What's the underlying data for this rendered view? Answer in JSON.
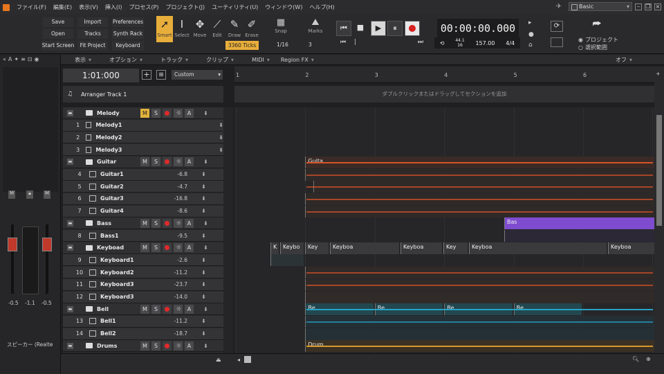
{
  "menu": [
    "ファイル(F)",
    "編集(E)",
    "表示(V)",
    "挿入(I)",
    "プロセス(P)",
    "プロジェクト(J)",
    "ユーティリティ(U)",
    "ウィンドウ(W)",
    "ヘルプ(H)"
  ],
  "workspace": "Basic",
  "toolbar": {
    "buttons": [
      "Save",
      "Import",
      "Preferences",
      "Open",
      "Tracks",
      "Synth Rack",
      "Start Screen",
      "Fit Project",
      "Keyboard"
    ],
    "tools": [
      "Smart",
      "Select",
      "Move",
      "Edit",
      "Draw",
      "Erase"
    ],
    "ticks": "3360 Ticks",
    "snap_label": "Snap",
    "snap_value": "1/16",
    "snap_num": "3",
    "marks_label": "Marks"
  },
  "transport": {
    "time": "00:00:00.000",
    "sample_rate": "44.1",
    "bit_depth": "16",
    "tempo": "157.00",
    "meter": "4/4",
    "project_label": "プロジェクト",
    "selection_label": "選択範囲"
  },
  "track_header": {
    "view_menus": [
      "表示",
      "オプション",
      "トラック",
      "クリップ",
      "MIDI",
      "Region FX"
    ],
    "now_time": "1:01:000",
    "preset": "Custom",
    "off_label": "オフ"
  },
  "arranger": {
    "name": "Arranger Track 1",
    "hint": "ダブルクリックまたはドラッグしてセクションを追加"
  },
  "ruler": [
    "1",
    "2",
    "3",
    "4",
    "5",
    "6"
  ],
  "mixer": {
    "vol_left": "-0.5",
    "vol_mid": "-1.1",
    "vol_right": "-0.5",
    "output": "スピーカー (Realte"
  },
  "tracks": [
    {
      "type": "folder",
      "name": "Melody",
      "mute": true
    },
    {
      "type": "track",
      "num": "1",
      "name": "Melody1",
      "vol": ""
    },
    {
      "type": "track",
      "num": "2",
      "name": "Melody2",
      "vol": ""
    },
    {
      "type": "track",
      "num": "3",
      "name": "Melody3",
      "vol": ""
    },
    {
      "type": "folder",
      "name": "Guitar"
    },
    {
      "type": "track",
      "num": "4",
      "name": "Guitar1",
      "vol": "-6.8"
    },
    {
      "type": "track",
      "num": "5",
      "name": "Guitar2",
      "vol": "-4.7"
    },
    {
      "type": "track",
      "num": "6",
      "name": "Guitar3",
      "vol": "-16.8"
    },
    {
      "type": "track",
      "num": "7",
      "name": "Guitar4",
      "vol": "-8.6"
    },
    {
      "type": "folder",
      "name": "Bass"
    },
    {
      "type": "track",
      "num": "8",
      "name": "Bass1",
      "vol": "-9.5"
    },
    {
      "type": "folder",
      "name": "Keyboad"
    },
    {
      "type": "track",
      "num": "9",
      "name": "Keyboard1",
      "vol": "-2.6"
    },
    {
      "type": "track",
      "num": "10",
      "name": "Keyboard2",
      "vol": "-11.2"
    },
    {
      "type": "track",
      "num": "11",
      "name": "Keyboard3",
      "vol": "-23.7"
    },
    {
      "type": "track",
      "num": "12",
      "name": "Keyboard3",
      "vol": "-14.0"
    },
    {
      "type": "folder",
      "name": "Bell"
    },
    {
      "type": "track",
      "num": "13",
      "name": "Bell1",
      "vol": "-11.2"
    },
    {
      "type": "track",
      "num": "14",
      "name": "Bell2",
      "vol": "-18.7"
    },
    {
      "type": "folder",
      "name": "Drums"
    }
  ],
  "clips": {
    "guitar": "Guita",
    "bass": "Bas",
    "keyboard": [
      "K",
      "Keybo",
      "Key",
      "Keyboa",
      "Keyboa",
      "Key",
      "Keyboa",
      "Keyboa"
    ],
    "bell": [
      "Be",
      "Be",
      "Be",
      "Be"
    ],
    "drums": "Drum"
  },
  "colors": {
    "guitar": "#d8532a",
    "bass": "#7f4ccf",
    "bell": "#27a3c7",
    "drums": "#d89a2a",
    "accent": "#e8ae3b"
  }
}
